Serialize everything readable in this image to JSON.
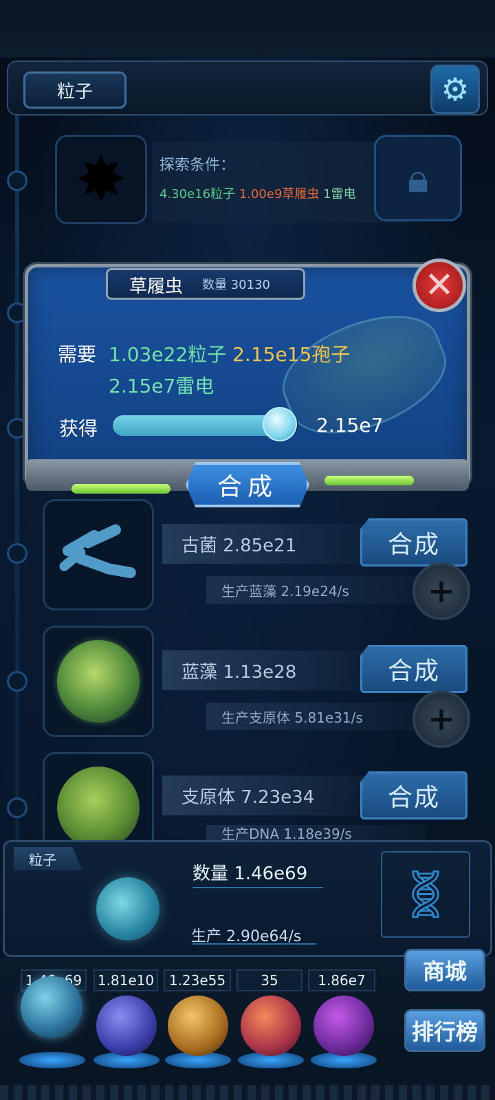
{
  "header": {
    "title": "粒子"
  },
  "explore": {
    "label": "探索条件：",
    "req_particles": "4.30e16粒子",
    "req_bug": "1.00e9草履虫",
    "req_thunder": "1雷电"
  },
  "modal": {
    "title": "草履虫",
    "count": "数量 30130",
    "need_label": "需要",
    "need_particles": "1.03e22粒子",
    "need_spores": "2.15e15孢子",
    "need_thunder": "2.15e7雷电",
    "gain_label": "获得",
    "gain_value": "2.15e7",
    "slider_fraction": 0.9,
    "synth_label": "合成"
  },
  "rows": [
    {
      "name": "古菌 2.85e21",
      "produce": "生产蓝藻 2.19e24/s",
      "button": "合成"
    },
    {
      "name": "蓝藻 1.13e28",
      "produce": "生产支原体 5.81e31/s",
      "button": "合成"
    },
    {
      "name": "支原体 7.23e34",
      "produce": "生产DNA 1.18e39/s",
      "button": "合成"
    }
  ],
  "bottom": {
    "tag": "粒子",
    "count": "数量 1.46e69",
    "produce": "生产 2.90e64/s"
  },
  "resources": [
    {
      "value": "1.46e69"
    },
    {
      "value": "1.81e10"
    },
    {
      "value": "1.23e55"
    },
    {
      "value": "35"
    },
    {
      "value": "1.86e7"
    }
  ],
  "side": {
    "shop": "商城",
    "rank": "排行榜"
  },
  "colors": {
    "panel_blue": "#123f7c",
    "accent_green": "#71e3a2",
    "accent_yellow": "#f2c54b",
    "accent_orange": "#e86a35"
  }
}
